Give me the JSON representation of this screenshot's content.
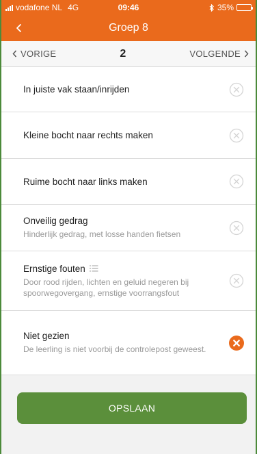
{
  "status_bar": {
    "carrier": "vodafone NL",
    "network": "4G",
    "time": "09:46",
    "bluetooth_icon": "bluetooth-icon",
    "battery_percent": "35%",
    "battery_level": 0.35
  },
  "nav": {
    "title": "Groep 8",
    "back_icon": "chevron-left-icon"
  },
  "pager": {
    "prev_label": "VORIGE",
    "next_label": "VOLGENDE",
    "current": "2"
  },
  "items": [
    {
      "title": "In juiste vak staan/inrijden",
      "subtitle": "",
      "has_list_icon": false,
      "selected": false
    },
    {
      "title": "Kleine bocht naar rechts maken",
      "subtitle": "",
      "has_list_icon": false,
      "selected": false
    },
    {
      "title": "Ruime bocht naar links maken",
      "subtitle": "",
      "has_list_icon": false,
      "selected": false
    },
    {
      "title": "Onveilig gedrag",
      "subtitle": "Hinderlijk gedrag, met losse handen fietsen",
      "has_list_icon": false,
      "selected": false
    },
    {
      "title": "Ernstige fouten",
      "subtitle": "Door rood rijden, lichten en geluid negeren bij spoorwegovergang, ernstige voorrangsfout",
      "has_list_icon": true,
      "selected": false
    },
    {
      "title": "Niet gezien",
      "subtitle": "De leerling is niet voorbij de controlepost geweest.",
      "has_list_icon": false,
      "selected": true
    }
  ],
  "footer": {
    "save_label": "OPSLAAN"
  },
  "colors": {
    "accent": "#ea6a1c",
    "save_button": "#5b8f3b",
    "frame_border": "#4c8a3a",
    "inactive_icon": "#d4d4d4"
  }
}
